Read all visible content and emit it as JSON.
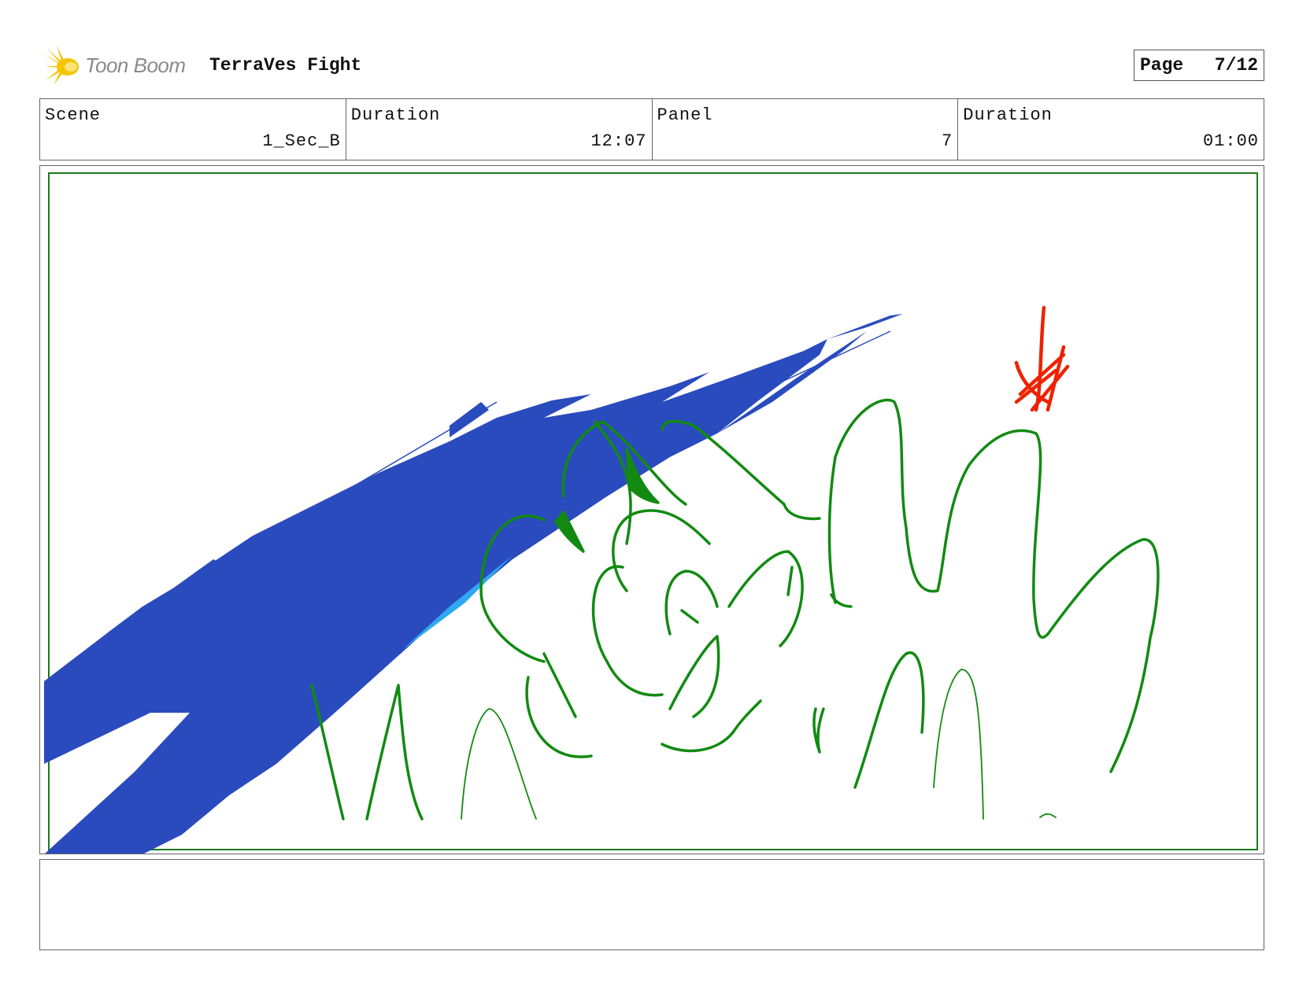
{
  "header": {
    "brand": "Toon Boom",
    "project_title": "TerraVes Fight",
    "page_label": "Page",
    "page_number": "7/12"
  },
  "info": {
    "scene_label": "Scene",
    "scene_value": "1_Sec_B",
    "scene_duration_label": "Duration",
    "scene_duration_value": "12:07",
    "panel_label": "Panel",
    "panel_value": "7",
    "panel_duration_label": "Duration",
    "panel_duration_value": "01:00"
  },
  "notes": {
    "text": ""
  },
  "colors": {
    "sketch_blue": "#2a4bbd",
    "sketch_light_blue": "#2fa8f0",
    "sketch_green": "#128a12",
    "sketch_red": "#ee2200",
    "safe_frame": "#1c7a1c",
    "logo_yellow": "#f5c400"
  }
}
